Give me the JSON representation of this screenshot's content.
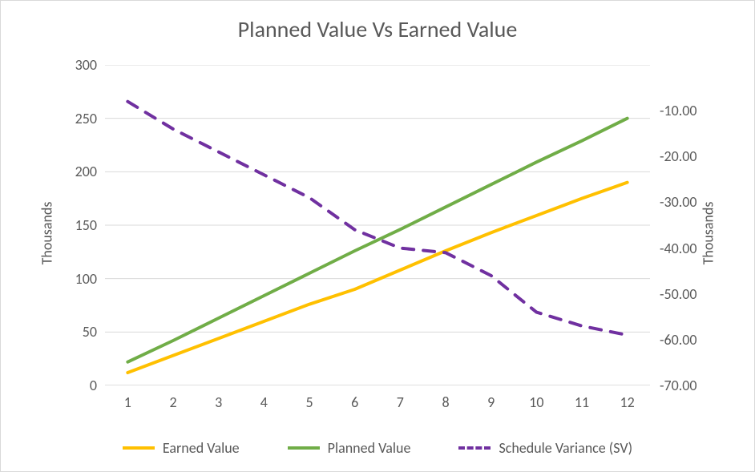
{
  "chart_data": {
    "type": "line",
    "title": "Planned Value Vs Earned Value",
    "x": [
      1,
      2,
      3,
      4,
      5,
      6,
      7,
      8,
      9,
      10,
      11,
      12
    ],
    "series": [
      {
        "name": "Earned Value",
        "axis": "left",
        "color": "#ffc000",
        "dash": "solid",
        "values": [
          12,
          28,
          44,
          60,
          76,
          90,
          108,
          126,
          143,
          159,
          175,
          190
        ]
      },
      {
        "name": "Planned Value",
        "axis": "left",
        "color": "#70ad47",
        "dash": "solid",
        "values": [
          22,
          42,
          63,
          84,
          105,
          126,
          146,
          167,
          188,
          209,
          229,
          250
        ]
      },
      {
        "name": "Schedule Variance (SV)",
        "axis": "right",
        "color": "#7030a0",
        "dash": "dashed",
        "values": [
          -8.0,
          -14.0,
          -19.0,
          -24.0,
          -29.0,
          -36.0,
          -40.0,
          -41.0,
          -46.0,
          -54.0,
          -57.0,
          -59.0
        ]
      }
    ],
    "left_axis": {
      "title": "Thousands",
      "min": 0,
      "max": 300,
      "ticks": [
        0,
        50,
        100,
        150,
        200,
        250,
        300
      ]
    },
    "right_axis": {
      "title": "Thousands",
      "min": -70,
      "max": 0,
      "ticks": [
        -10,
        -20,
        -30,
        -40,
        -50,
        -60,
        -70
      ]
    },
    "grid": true,
    "legend_position": "bottom"
  },
  "legend_labels": {
    "ev": "Earned Value",
    "pv": "Planned Value",
    "sv": "Schedule Variance (SV)"
  },
  "axis_titles": {
    "left": "Thousands",
    "right": "Thousands"
  },
  "y_left_ticks": [
    "0",
    "50",
    "100",
    "150",
    "200",
    "250",
    "300"
  ],
  "y_right_ticks": [
    "-10.00",
    "-20.00",
    "-30.00",
    "-40.00",
    "-50.00",
    "-60.00",
    "-70.00"
  ],
  "x_ticks": [
    "1",
    "2",
    "3",
    "4",
    "5",
    "6",
    "7",
    "8",
    "9",
    "10",
    "11",
    "12"
  ],
  "title": "Planned Value Vs Earned Value"
}
